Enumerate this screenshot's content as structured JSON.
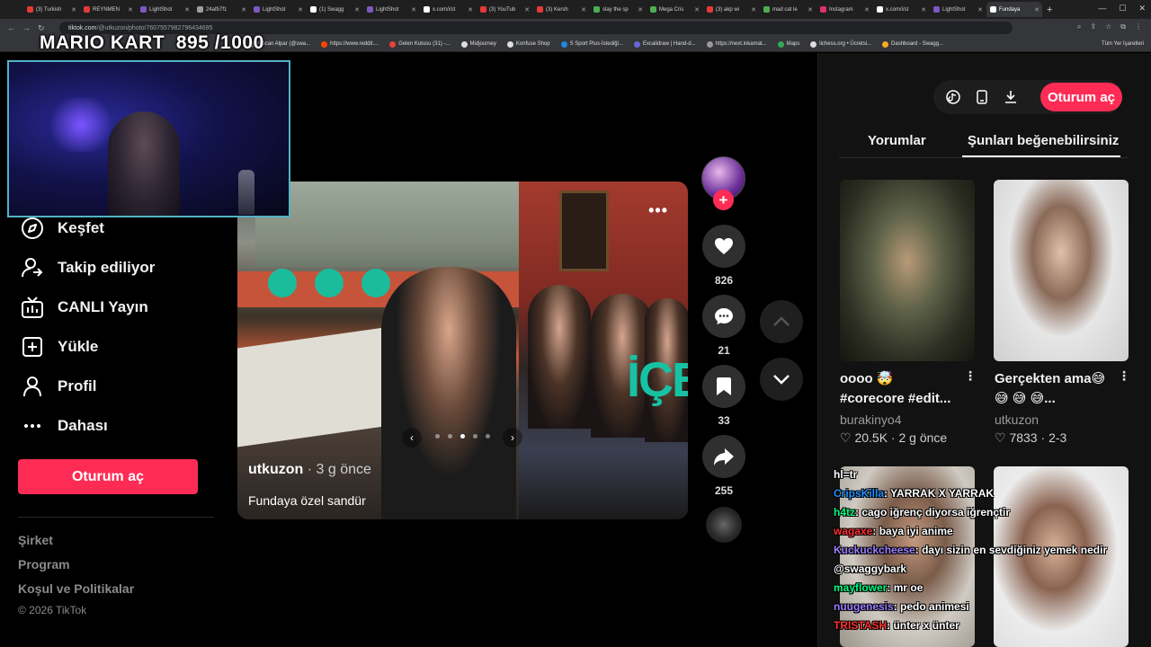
{
  "browser": {
    "tabs": [
      {
        "label": "(3) Turkish",
        "color": "#e53935"
      },
      {
        "label": "REYNMEN",
        "color": "#e53935"
      },
      {
        "label": "LightShot",
        "color": "#7e57c2"
      },
      {
        "label": "24afb7f1",
        "color": "#9e9e9e"
      },
      {
        "label": "LightShot",
        "color": "#7e57c2"
      },
      {
        "label": "(1) Swagg",
        "color": "#fff"
      },
      {
        "label": "LightShot",
        "color": "#7e57c2"
      },
      {
        "label": "x.com/i/st",
        "color": "#fff"
      },
      {
        "label": "(3) YouTub",
        "color": "#e53935"
      },
      {
        "label": "(3) Kersh",
        "color": "#e53935"
      },
      {
        "label": "slay the sp",
        "color": "#4caf50"
      },
      {
        "label": "Mega Cris",
        "color": "#4caf50"
      },
      {
        "label": "(3) akp wi",
        "color": "#e53935"
      },
      {
        "label": "mad cat le",
        "color": "#4caf50"
      },
      {
        "label": "Instagram",
        "color": "#e1306c"
      },
      {
        "label": "x.com/i/st",
        "color": "#fff"
      },
      {
        "label": "LightShot",
        "color": "#7e57c2"
      },
      {
        "label": "Fundaya",
        "color": "#fff"
      }
    ],
    "url_host": "tiktok.com",
    "url_path": "/@utkuzon/photo/7607557982796434695",
    "bookmarks": [
      {
        "label": "Alpcan Alpar (@swa...",
        "color": "#999"
      },
      {
        "label": "https://www.reddit....",
        "color": "#ff4500"
      },
      {
        "label": "Gelen Kutusu (31) -...",
        "color": "#ea4335"
      },
      {
        "label": "Midjourney",
        "color": "#ddd"
      },
      {
        "label": "Konfuse Shop",
        "color": "#ddd"
      },
      {
        "label": "S Sport Plus-İstediği...",
        "color": "#1e88e5"
      },
      {
        "label": "Excalidraw | Hand-d...",
        "color": "#6965db"
      },
      {
        "label": "https://next.inkamat...",
        "color": "#999"
      },
      {
        "label": "Maps",
        "color": "#34a853"
      },
      {
        "label": "lichess.org • Ücretsi...",
        "color": "#ddd"
      },
      {
        "label": "Dashboard - Swagg...",
        "color": "#f9a825"
      }
    ],
    "bookmarks_all": "Tüm Yer İşaretleri"
  },
  "overlay": {
    "title": "MARIO KART",
    "score": "895 /1000"
  },
  "nav": {
    "items": [
      {
        "label": "Keşfet",
        "icon": "compass-icon"
      },
      {
        "label": "Takip ediliyor",
        "icon": "following-icon"
      },
      {
        "label": "CANLI Yayın",
        "icon": "live-icon"
      },
      {
        "label": "Yükle",
        "icon": "upload-icon"
      },
      {
        "label": "Profil",
        "icon": "profile-icon"
      },
      {
        "label": "Dahası",
        "icon": "more-icon"
      }
    ],
    "login_label": "Oturum aç",
    "footer": [
      "Şirket",
      "Program",
      "Koşul ve Politikalar"
    ],
    "copyright": "© 2026 TikTok"
  },
  "post": {
    "author": "utkuzon",
    "time": " · 3 g önce",
    "caption": "Fundaya özel sandür",
    "overlay_text": "İÇE",
    "likes": "826",
    "comments": "21",
    "saves": "33",
    "shares": "255",
    "photo_count": 5,
    "current_photo": 3
  },
  "panel": {
    "login_label": "Oturum aç",
    "tab_comments": "Yorumlar",
    "tab_suggested": "Şunları beğenebilirsiniz",
    "cards": [
      {
        "title": "oooo 🤯",
        "title2": "#corecore #edit...",
        "author": "burakinyo4",
        "likes": "20.5K",
        "time": "2 g önce"
      },
      {
        "title": "Gerçekten ama😅",
        "title2": "😅 😅 😅...",
        "author": "utkuzon",
        "likes": "7833",
        "time": "2-3"
      }
    ]
  },
  "chat": [
    {
      "user": "hl=tr",
      "msg": "",
      "color": "#ffffff"
    },
    {
      "user": "CripsKilla",
      "msg": ": YARRAK X YARRAK",
      "color": "#1e90ff"
    },
    {
      "user": "h4tz",
      "msg": ": cago iğrenç diyorsa iğrençtir",
      "color": "#00ff7f"
    },
    {
      "user": "wagaxe",
      "msg": ": baya iyi anime",
      "color": "#ff3030"
    },
    {
      "user": "Kuckuckcheese",
      "msg": ": dayı sizin en sevdiğiniz yemek nedir",
      "color": "#9a7dff"
    },
    {
      "user": "@swaggybark",
      "msg": "",
      "color": "#ffffff"
    },
    {
      "user": "mayflower",
      "msg": ": mr oe",
      "color": "#00ff7f"
    },
    {
      "user": "nuugenesis",
      "msg": ": pedo animesi",
      "color": "#9a7dff"
    },
    {
      "user": "TRISTASH",
      "msg": ": ünter x ünter",
      "color": "#ff3030"
    }
  ]
}
